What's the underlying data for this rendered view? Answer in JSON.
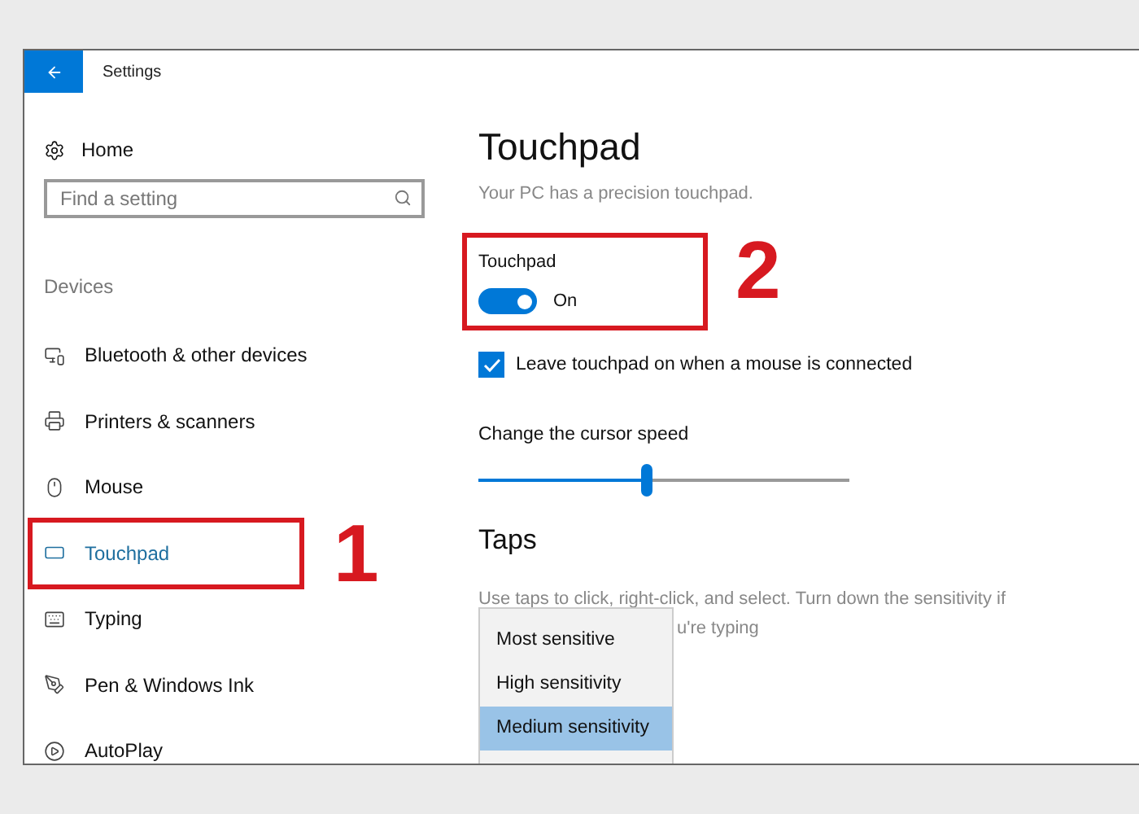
{
  "window": {
    "title": "Settings"
  },
  "sidebar": {
    "home": "Home",
    "search": {
      "placeholder": "Find a setting"
    },
    "section": "Devices",
    "items": [
      {
        "label": "Bluetooth & other devices",
        "kind": "devices",
        "selected": false
      },
      {
        "label": "Printers & scanners",
        "kind": "printer",
        "selected": false
      },
      {
        "label": "Mouse",
        "kind": "mouse",
        "selected": false
      },
      {
        "label": "Touchpad",
        "kind": "touchpad",
        "selected": true
      },
      {
        "label": "Typing",
        "kind": "keyboard",
        "selected": false
      },
      {
        "label": "Pen & Windows Ink",
        "kind": "pen",
        "selected": false
      },
      {
        "label": "AutoPlay",
        "kind": "autoplay",
        "selected": false
      }
    ]
  },
  "main": {
    "title": "Touchpad",
    "subtitle": "Your PC has a precision touchpad.",
    "toggle": {
      "label": "Touchpad",
      "on": true,
      "state_text": "On"
    },
    "checkbox": {
      "label": "Leave touchpad on when a mouse is connected",
      "checked": true
    },
    "slider": {
      "label": "Change the cursor speed",
      "level": 0.45
    },
    "taps": {
      "heading": "Taps",
      "description": "Use taps to click, right-click, and select. Turn down the sensitivity if",
      "description_tail": "u're typing",
      "dropdown": {
        "options": [
          {
            "label": "Most sensitive",
            "selected": false
          },
          {
            "label": "High sensitivity",
            "selected": false
          },
          {
            "label": "Medium sensitivity",
            "selected": true
          }
        ]
      }
    }
  },
  "annotations": [
    {
      "label": "1"
    },
    {
      "label": "2"
    }
  ]
}
